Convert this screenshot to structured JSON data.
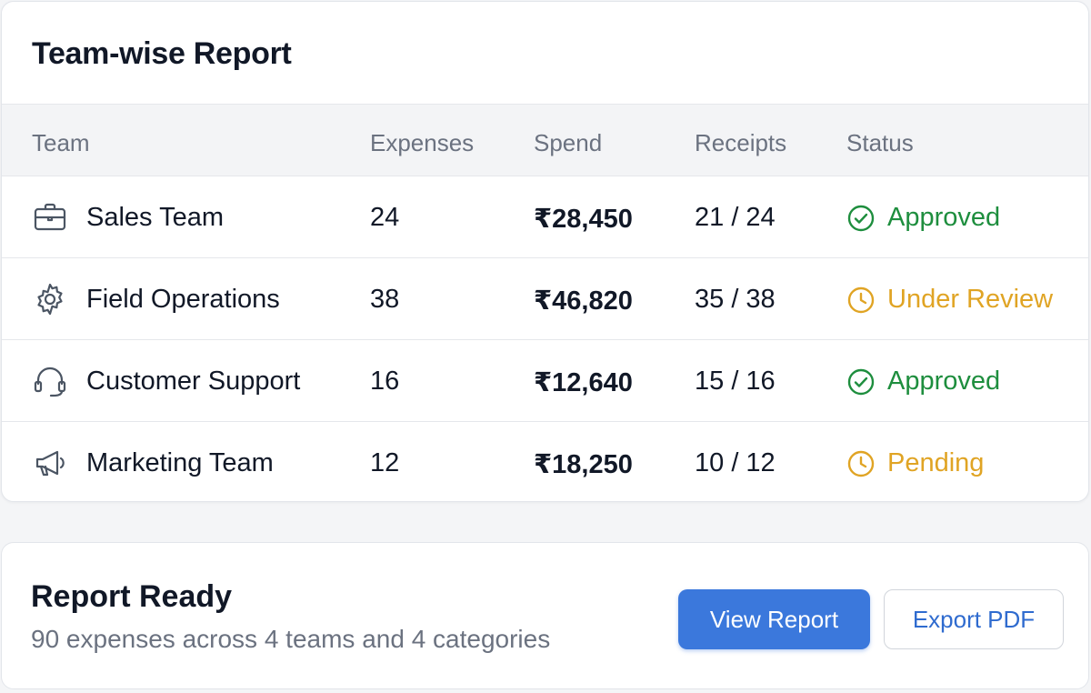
{
  "report": {
    "title": "Team-wise Report",
    "columns": [
      "Team",
      "Expenses",
      "Spend",
      "Receipts",
      "Status"
    ],
    "rows": [
      {
        "icon": "briefcase-icon",
        "team": "Sales Team",
        "expenses": "24",
        "spend": "₹28,450",
        "receipts": "21 / 24",
        "status": "Approved",
        "status_type": "approved"
      },
      {
        "icon": "gear-icon",
        "team": "Field Operations",
        "expenses": "38",
        "spend": "₹46,820",
        "receipts": "35 / 38",
        "status": "Under Review",
        "status_type": "review"
      },
      {
        "icon": "headset-icon",
        "team": "Customer Support",
        "expenses": "16",
        "spend": "₹12,640",
        "receipts": "15 / 16",
        "status": "Approved",
        "status_type": "approved"
      },
      {
        "icon": "megaphone-icon",
        "team": "Marketing Team",
        "expenses": "12",
        "spend": "₹18,250",
        "receipts": "10 / 12",
        "status": "Pending",
        "status_type": "pending"
      }
    ]
  },
  "footer": {
    "title": "Report Ready",
    "subtitle": "90 expenses across 4 teams and 4 categories",
    "view_label": "View Report",
    "export_label": "Export PDF"
  },
  "colors": {
    "approved": "#1e8e3e",
    "pending": "#e0a424",
    "primary": "#3b78dc",
    "icon": "#4b5563"
  }
}
